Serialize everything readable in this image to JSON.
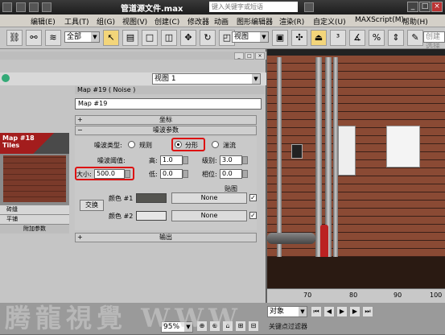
{
  "titlebar": {
    "title": "管道源文件.max",
    "search_placeholder": "键入关键字或短语"
  },
  "menu": [
    "编辑(E)",
    "工具(T)",
    "组(G)",
    "视图(V)",
    "创建(C)",
    "修改器",
    "动画",
    "图形编辑器",
    "渲染(R)",
    "自定义(U)",
    "MAXScript(M)",
    "帮助(H)"
  ],
  "toolbar": {
    "selection_filter": "全部",
    "ref_coord": "视图",
    "create_selection": "创建选择"
  },
  "material_editor": {
    "view_dropdown": "视图 1",
    "panel_header": "Map #19  ( Noise )",
    "map_name": "Map #19",
    "rollout_coords": "坐标",
    "rollout_noise": "噪波参数",
    "noise_type_label": "噪波类型:",
    "noise_types": [
      "规则",
      "分形",
      "湍流"
    ],
    "threshold_label": "噪波阈值:",
    "high_label": "高:",
    "high_value": "1.0",
    "levels_label": "级别:",
    "levels_value": "3.0",
    "low_label": "低:",
    "low_value": "0.0",
    "phase_label": "相位:",
    "phase_value": "0.0",
    "size_label": "大小:",
    "size_value": "500.0",
    "maps_label": "贴图",
    "swap_label": "交换",
    "color1_label": "颜色 #1",
    "color1_map": "None",
    "color1": "#545450",
    "color2_label": "颜色 #2",
    "color2_map": "None",
    "color2": "#e6e6e6",
    "rollout_output": "输出"
  },
  "map_slot": {
    "title": "Map #18",
    "subtitle": "Tiles",
    "rows": [
      "砖缝",
      "平铺",
      "附加参数"
    ]
  },
  "timeline": {
    "ticks": [
      "70",
      "80",
      "90",
      "100"
    ]
  },
  "status": {
    "zoom": "95%",
    "object_label": "对象",
    "keyfilter": "关键点过滤器"
  },
  "watermark": "腾龍視覺 WWW",
  "colors": {
    "highlight": "#d11111",
    "map_header": "#a31d1d"
  }
}
